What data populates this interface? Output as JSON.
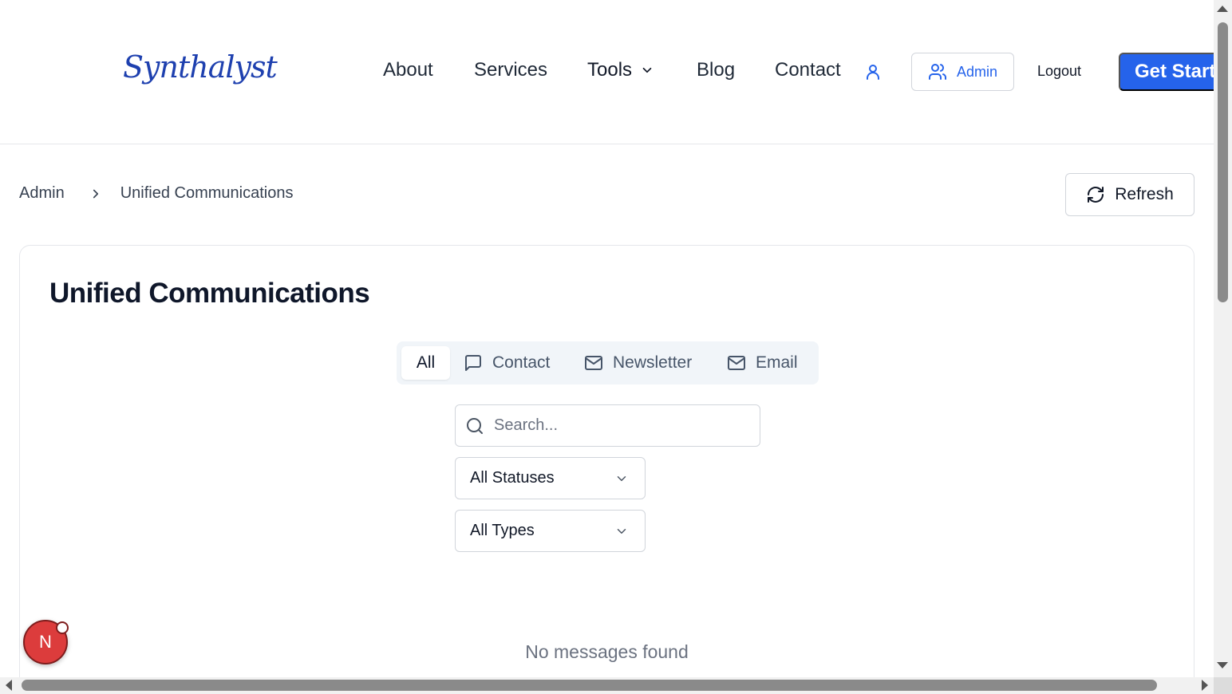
{
  "header": {
    "logo": "Synthalyst",
    "nav": {
      "about": "About",
      "services": "Services",
      "tools": "Tools",
      "blog": "Blog",
      "contact": "Contact"
    },
    "admin_label": "Admin",
    "logout_label": "Logout",
    "cta_label": "Get Started"
  },
  "breadcrumb": {
    "root": "Admin",
    "current": "Unified Communications"
  },
  "refresh_label": "Refresh",
  "main": {
    "title": "Unified Communications",
    "tabs": [
      {
        "label": "All",
        "icon": "none",
        "active": true
      },
      {
        "label": "Contact",
        "icon": "message-square-icon",
        "active": false
      },
      {
        "label": "Newsletter",
        "icon": "mail-icon",
        "active": false
      },
      {
        "label": "Email",
        "icon": "mail-icon",
        "active": false
      }
    ],
    "search": {
      "placeholder": "Search...",
      "value": ""
    },
    "status_filter": "All Statuses",
    "type_filter": "All Types",
    "empty_message": "No messages found"
  },
  "dev_badge": "N",
  "colors": {
    "accent": "#2563eb",
    "logo": "#1e40af",
    "badge": "#dc3c3c"
  }
}
